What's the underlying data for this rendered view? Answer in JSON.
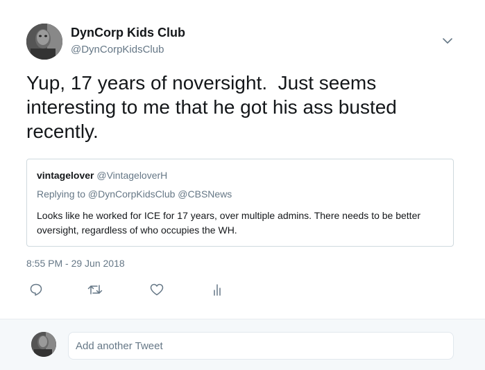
{
  "tweet": {
    "author_name": "DynCorp Kids Club",
    "author_handle": "@DynCorpKidsClub",
    "text": "Yup, 17 years of noversight.  Just seems interesting to me that he got his ass busted recently.",
    "timestamp": "8:55 PM - 29 Jun 2018",
    "avatar_icon": "profile-avatar",
    "menu_icon": "chevron-down-icon"
  },
  "quoted": {
    "author_name": "vintagelover",
    "author_handle": "@VintageloverH",
    "replying_to": "Replying to @DynCorpKidsClub @CBSNews",
    "text": "Looks like he worked for ICE for 17 years, over multiple admins. There needs to be better oversight, regardless of who occupies the WH."
  },
  "actions": [
    {
      "name": "reply",
      "icon": "reply-icon"
    },
    {
      "name": "retweet",
      "icon": "retweet-icon"
    },
    {
      "name": "like",
      "icon": "heart-icon"
    },
    {
      "name": "analytics",
      "icon": "analytics-icon"
    }
  ],
  "reply_box": {
    "placeholder": "Add another Tweet"
  },
  "colors": {
    "text": "#14171a",
    "secondary": "#657786",
    "border": "#cfd9de",
    "reply_bg": "#f5f8fa"
  }
}
